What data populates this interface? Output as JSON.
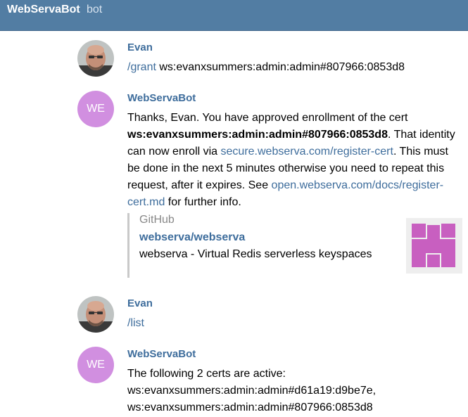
{
  "header": {
    "title": "WebServaBot",
    "subtitle": "bot"
  },
  "messages": [
    {
      "author": "Evan",
      "command": "/grant",
      "text": " ws:evanxsummers:admin:admin#807966:0853d8"
    },
    {
      "author": "WebServaBot",
      "avatar_initials": "WE",
      "parts": {
        "p1": "Thanks, Evan. You have approved enrollment of the cert ",
        "cert": "ws:evanxsummers:admin:admin#807966:0853d8",
        "p2": ". That identity can now enroll via ",
        "link1": "secure.webserva.com/register-cert",
        "p3": ". This must be done in the next 5 minutes otherwise you need to repeat this request, after it expires. See ",
        "link2": "open.webserva.com/docs/register-cert.md",
        "p4": " for further info."
      },
      "preview": {
        "site": "GitHub",
        "title": "webserva/webserva",
        "description": "webserva - Virtual Redis serverless keyspaces",
        "thumbnail_icon": "identicon-icon"
      }
    },
    {
      "author": "Evan",
      "command": "/list"
    },
    {
      "author": "WebServaBot",
      "avatar_initials": "WE",
      "lines": [
        "The following 2 certs are active:",
        "ws:evanxsummers:admin:admin#d61a19:d9be7e,",
        "ws:evanxsummers:admin:admin#807966:0853d8"
      ]
    }
  ],
  "colors": {
    "header_bg": "#527da3",
    "bot_avatar": "#d18fe0",
    "link": "#3e6d9c",
    "identicon": "#c85fc0"
  }
}
